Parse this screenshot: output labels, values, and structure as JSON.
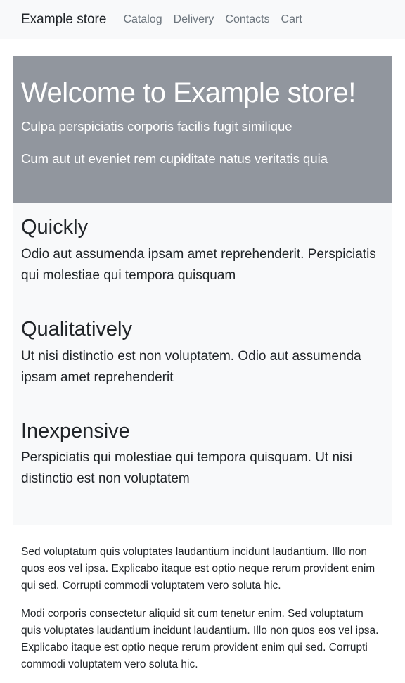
{
  "navbar": {
    "brand": "Example store",
    "links": [
      "Catalog",
      "Delivery",
      "Contacts",
      "Cart"
    ]
  },
  "hero": {
    "title": "Welcome to Example store!",
    "lines": [
      "Culpa perspiciatis corporis facilis fugit similique",
      "Cum aut ut eveniet rem cupiditate natus veritatis quia"
    ]
  },
  "features": [
    {
      "title": "Quickly",
      "text": "Odio aut assumenda ipsam amet reprehenderit. Perspiciatis qui molestiae qui tempora quisquam"
    },
    {
      "title": "Qualitatively",
      "text": "Ut nisi distinctio est non voluptatem. Odio aut assumenda ipsam amet reprehenderit"
    },
    {
      "title": "Inexpensive",
      "text": "Perspiciatis qui molestiae qui tempora quisquam. Ut nisi distinctio est non voluptatem"
    }
  ],
  "content": {
    "paragraphs": [
      "Sed voluptatum quis voluptates laudantium incidunt laudantium. Illo non quos eos vel ipsa. Explicabo itaque est optio neque rerum provident enim qui sed. Corrupti commodi voluptatem vero soluta hic.",
      "Modi corporis consectetur aliquid sit cum tenetur enim. Sed voluptatum quis voluptates laudantium incidunt laudantium. Illo non quos eos vel ipsa. Explicabo itaque est optio neque rerum provident enim qui sed. Corrupti commodi voluptatem vero soluta hic."
    ]
  },
  "colors": {
    "navbar_bg": "#f8f9fa",
    "hero_bg": "#91969e",
    "features_bg": "#f8f9fa",
    "nav_link": "#6c757d",
    "text": "#212529"
  }
}
